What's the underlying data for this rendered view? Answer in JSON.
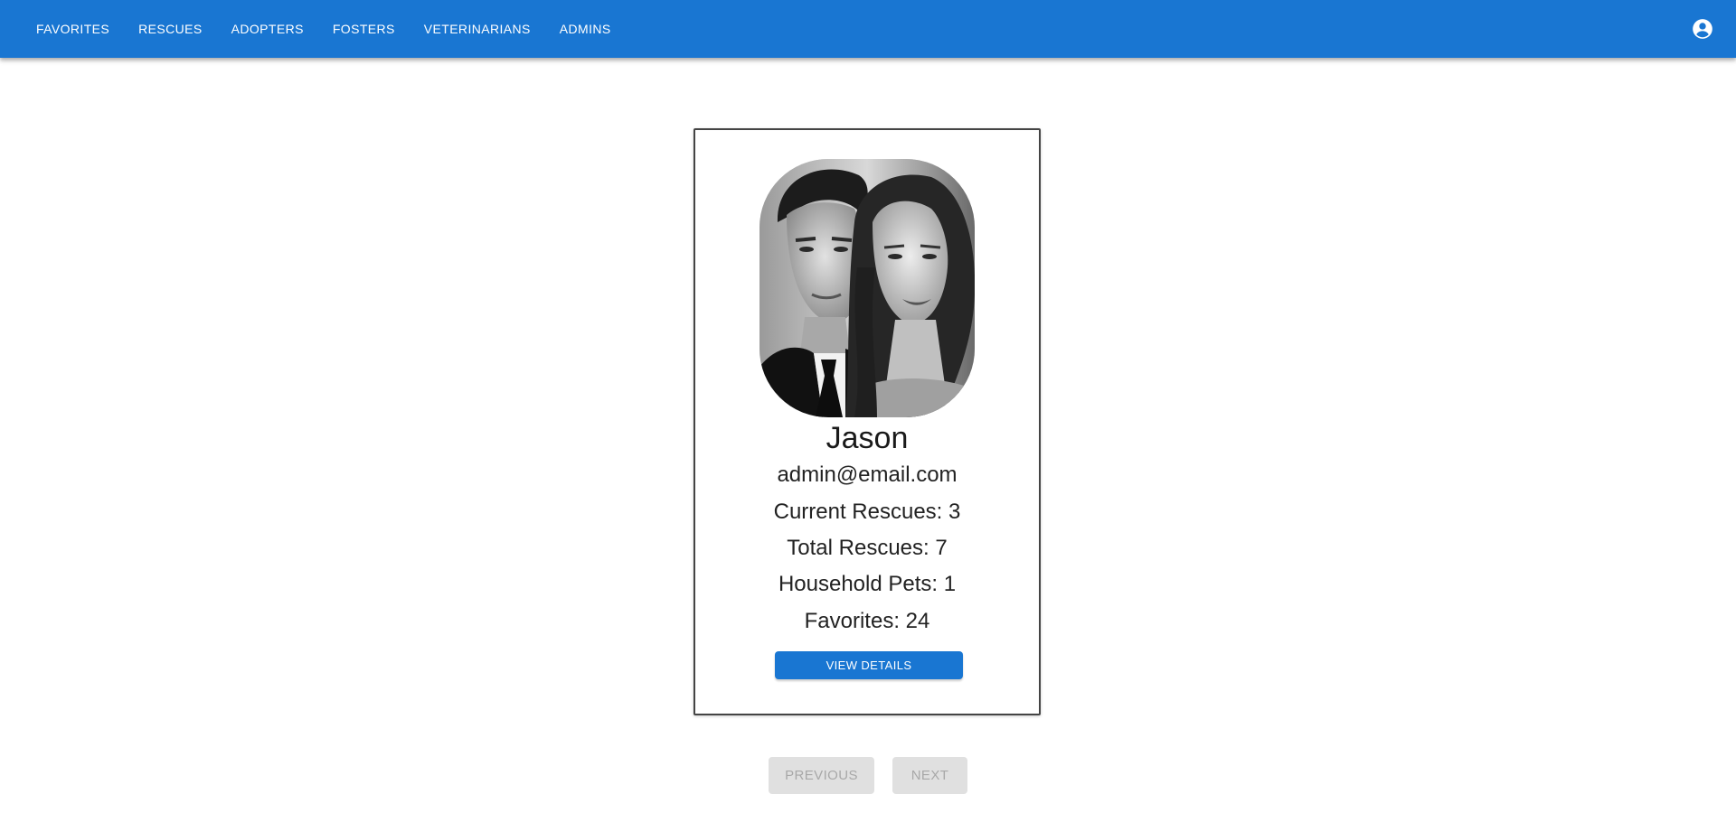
{
  "nav": {
    "items": [
      {
        "label": "FAVORITES"
      },
      {
        "label": "RESCUES"
      },
      {
        "label": "ADOPTERS"
      },
      {
        "label": "FOSTERS"
      },
      {
        "label": "VETERINARIANS"
      },
      {
        "label": "ADMINS"
      }
    ],
    "account_icon": "account-circle-icon"
  },
  "colors": {
    "primary": "#1976d2",
    "disabled_bg": "#e0e0e0",
    "disabled_text": "#a8a8a8"
  },
  "profile": {
    "photo_description": "",
    "name": "Jason",
    "email": "admin@email.com",
    "stats": [
      {
        "text": "Current Rescues: 3"
      },
      {
        "text": "Total Rescues: 7"
      },
      {
        "text": "Household Pets: 1"
      },
      {
        "text": "Favorites: 24"
      }
    ],
    "view_details_label": "VIEW DETAILS"
  },
  "pagination": {
    "previous_label": "PREVIOUS",
    "next_label": "NEXT",
    "previous_disabled": true,
    "next_disabled": true
  }
}
